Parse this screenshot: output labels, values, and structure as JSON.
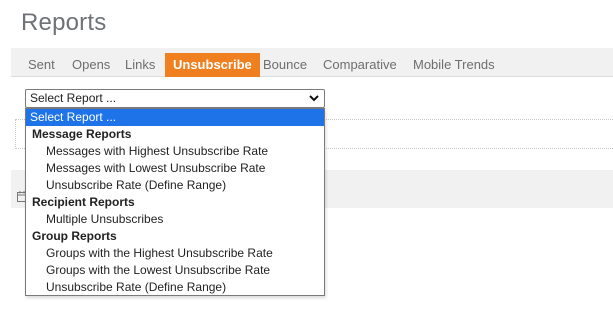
{
  "page": {
    "title": "Reports"
  },
  "tabs": [
    {
      "label": "Sent",
      "active": false
    },
    {
      "label": "Opens",
      "active": false
    },
    {
      "label": "Links",
      "active": false
    },
    {
      "label": "Unsubscribe",
      "active": true
    },
    {
      "label": "Bounce",
      "active": false
    },
    {
      "label": "Comparative",
      "active": false
    },
    {
      "label": "Mobile Trends",
      "active": false
    }
  ],
  "report_select": {
    "value": "Select Report ...",
    "options": [
      {
        "label": "Select Report ...",
        "kind": "option",
        "selected": true
      },
      {
        "label": "Message Reports",
        "kind": "group"
      },
      {
        "label": "Messages with Highest Unsubscribe Rate",
        "kind": "option"
      },
      {
        "label": "Messages with Lowest Unsubscribe Rate",
        "kind": "option"
      },
      {
        "label": "Unsubscribe Rate (Define Range)",
        "kind": "option"
      },
      {
        "label": "Recipient Reports",
        "kind": "group"
      },
      {
        "label": "Multiple Unsubscribes",
        "kind": "option"
      },
      {
        "label": "Group Reports",
        "kind": "group"
      },
      {
        "label": "Groups with the Highest Unsubscribe Rate",
        "kind": "option"
      },
      {
        "label": "Groups with the Lowest Unsubscribe Rate",
        "kind": "option"
      },
      {
        "label": "Unsubscribe Rate (Define Range)",
        "kind": "option"
      }
    ]
  },
  "colors": {
    "accent": "#f07f1f",
    "selection": "#1e73e8",
    "tabbar_bg": "#f1f1f1"
  },
  "icons": {
    "select_caret": "chevron-down-icon",
    "background_toolbar": "calendar-icon"
  }
}
